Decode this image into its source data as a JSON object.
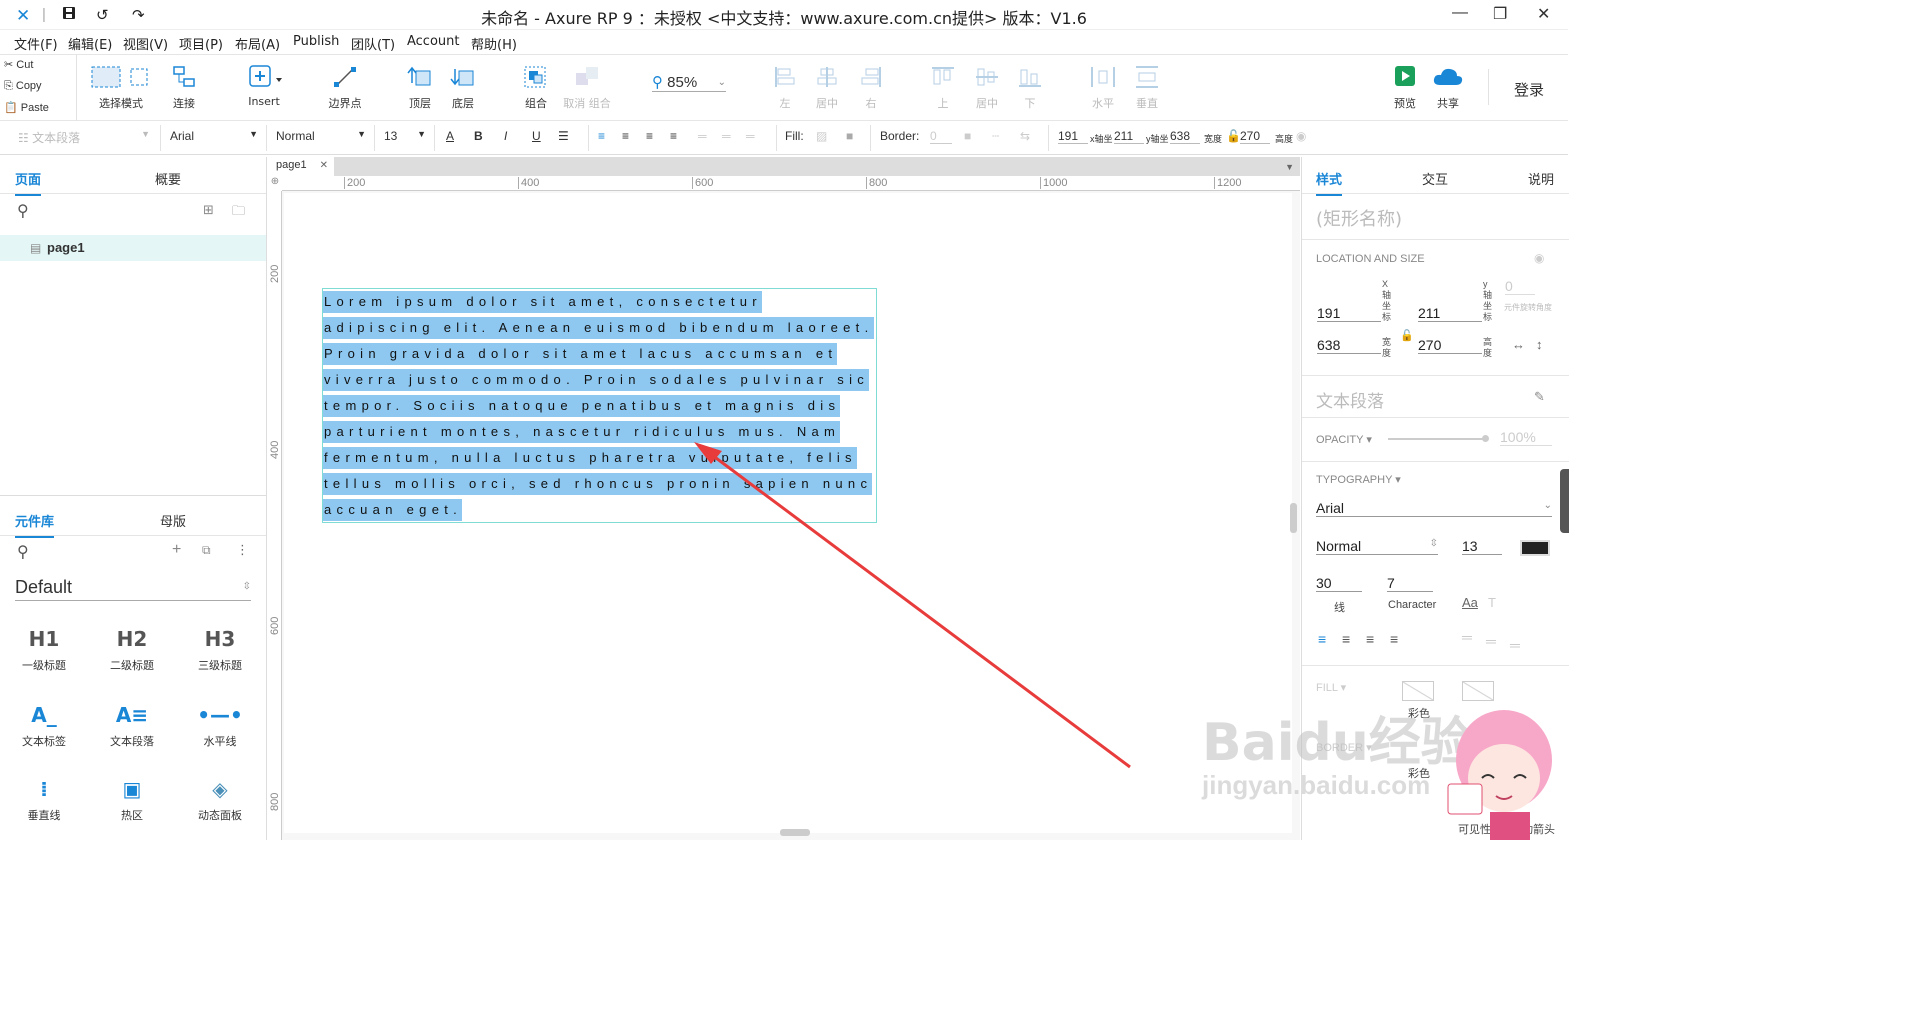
{
  "title": "未命名 - Axure RP 9 ：未授权   <中文支持：www.axure.com.cn提供> 版本：V1.6",
  "menu": [
    "文件(F)",
    "编辑(E)",
    "视图(V)",
    "项目(P)",
    "布局(A)",
    "Publish",
    "团队(T)",
    "Account",
    "帮助(H)"
  ],
  "clipboard": {
    "cut": "Cut",
    "copy": "Copy",
    "paste": "Paste"
  },
  "toolbar": {
    "select_mode": "选择模式",
    "connect": "连接",
    "insert": "Insert",
    "points": "边界点",
    "top": "顶层",
    "bottom": "底层",
    "group": "组合",
    "ungroup": "取消 组合",
    "zoom": "85%",
    "align_left": "左",
    "align_center": "居中",
    "align_right": "右",
    "align_top": "上",
    "align_middle": "居中",
    "align_bottom": "下",
    "dist_h": "水平",
    "dist_v": "垂直",
    "preview": "预览",
    "share": "共享",
    "login": "登录"
  },
  "formatbar": {
    "style": "文本段落",
    "font": "Arial",
    "weight": "Normal",
    "size": "13",
    "fill": "Fill:",
    "border": "Border:",
    "border_val": "0",
    "x": "191",
    "x_label": "x轴坐",
    "y": "211",
    "y_label": "y轴坐",
    "w": "638",
    "w_label": "宽度",
    "h": "270",
    "h_label": "高度"
  },
  "leftpanel": {
    "tab_pages": "页面",
    "tab_outline": "概要",
    "page_item": "page1",
    "tab_library": "元件库",
    "tab_masters": "母版",
    "library_name": "Default",
    "widgets": [
      {
        "icon": "H1",
        "label": "一级标题"
      },
      {
        "icon": "H2",
        "label": "二级标题"
      },
      {
        "icon": "H3",
        "label": "三级标题"
      },
      {
        "icon": "A_",
        "label": "文本标签"
      },
      {
        "icon": "A≡",
        "label": "文本段落"
      },
      {
        "icon": "•—•",
        "label": "水平线"
      },
      {
        "icon": "⁞",
        "label": "垂直线"
      },
      {
        "icon": "▣",
        "label": "热区"
      },
      {
        "icon": "◈",
        "label": "动态面板"
      }
    ]
  },
  "canvas": {
    "doc_tab": "page1",
    "hruler": [
      "200",
      "400",
      "600",
      "800",
      "1000",
      "1200"
    ],
    "vruler": [
      "200",
      "400",
      "600",
      "800"
    ],
    "text_lines": [
      "Lorem ipsum dolor sit amet, consectetur",
      "adipiscing elit. Aenean euismod bibendum laoreet.",
      "Proin gravida dolor sit amet lacus accumsan et",
      "viverra justo commodo. Proin sodales pulvinar sic",
      "tempor. Sociis natoque penatibus et magnis dis",
      "parturient montes, nascetur ridiculus mus. Nam",
      "fermentum, nulla luctus pharetra vulputate, felis",
      "tellus mollis orci, sed rhoncus pronin sapien nunc",
      "accuan eget."
    ]
  },
  "rightpanel": {
    "tab_style": "样式",
    "tab_interact": "交互",
    "tab_notes": "说明",
    "name_placeholder": "(矩形名称)",
    "loc_size": "LOCATION AND SIZE",
    "x": "191",
    "y": "211",
    "w": "638",
    "h": "270",
    "rot": "0",
    "x_label": "X轴坐标",
    "y_label": "y轴坐标",
    "w_label": "宽度",
    "h_label": "高度",
    "rot_label": "元件旋转角度",
    "style_name": "文本段落",
    "opacity": "OPACITY",
    "opacity_val": "100%",
    "typography": "TYPOGRAPHY",
    "font": "Arial",
    "weight": "Normal",
    "size": "13",
    "line_spacing": "30",
    "line_label": "线",
    "char_spacing": "7",
    "char_label": "Character",
    "fill": "FILL",
    "fill_label": "彩色",
    "border": "BORDER",
    "border_label": "彩色",
    "visible": "可见性",
    "arrow": "动箭头"
  },
  "watermark": {
    "brand": "Baidu经验",
    "url": "jingyan.baidu.com"
  },
  "colors": {
    "accent": "#1a86d6",
    "selection": "#8ec8f0",
    "arrow": "#e83b3b",
    "widget_border": "#7fdcd4"
  }
}
